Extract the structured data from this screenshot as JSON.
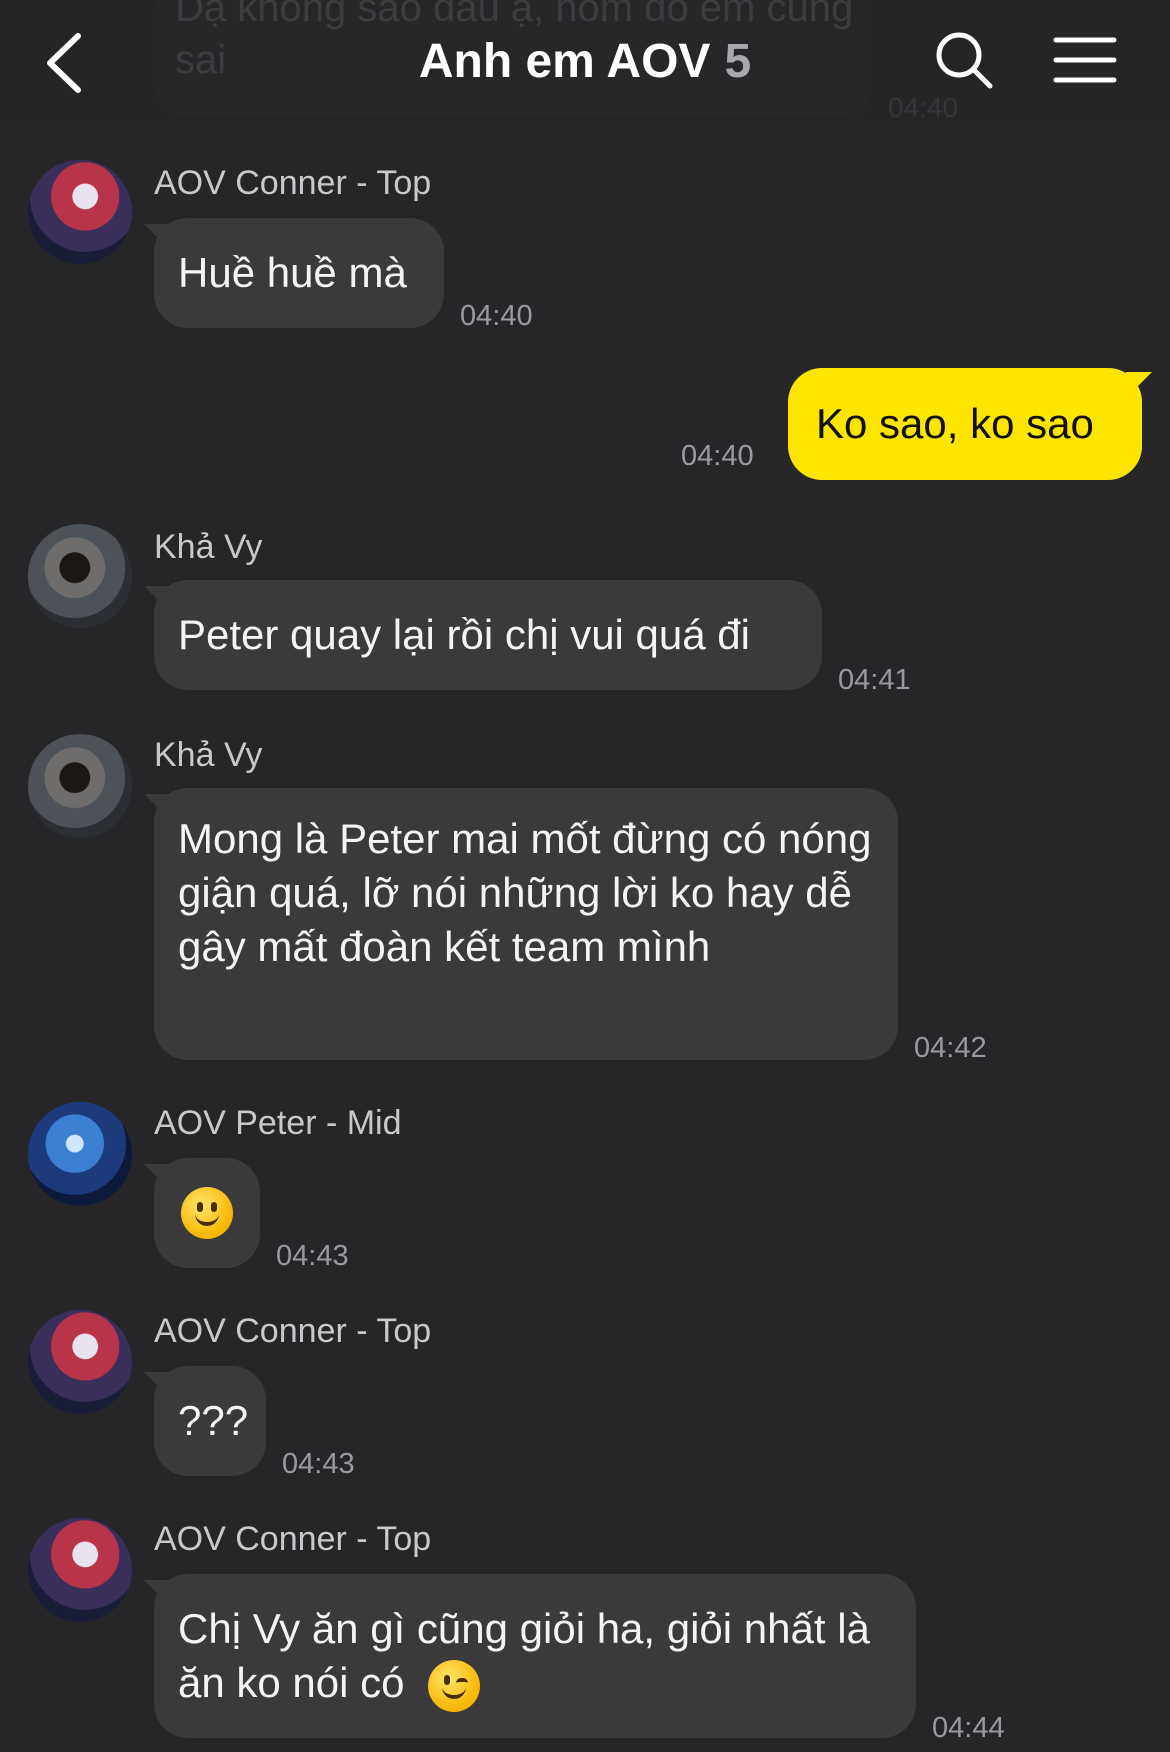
{
  "header": {
    "title": "Anh em AOV",
    "member_count": "5"
  },
  "ghost_message": {
    "text": "Dạ không sao đâu ạ, hôm đó em cũng sai",
    "time": "04:40"
  },
  "messages": [
    {
      "sender": "AOV Conner - Top",
      "text": "Huề huề mà",
      "time": "04:40"
    },
    {
      "sender": "",
      "text": "Ko sao, ko sao",
      "time": "04:40",
      "outgoing": true
    },
    {
      "sender": "Khả Vy",
      "text": "Peter quay lại rồi chị vui quá đi",
      "time": "04:41"
    },
    {
      "sender": "Khả Vy",
      "text": "Mong là Peter mai mốt đừng có nóng giận quá, lỡ nói những lời ko hay dễ gây mất đoàn kết team mình",
      "time": "04:42"
    },
    {
      "sender": "AOV Peter - Mid",
      "emoji": "slightly-smiling-face",
      "time": "04:43"
    },
    {
      "sender": "AOV Conner - Top",
      "text": "???",
      "time": "04:43"
    },
    {
      "sender": "AOV Conner - Top",
      "text": "Chị Vy ăn gì cũng giỏi ha, giỏi nhất là ăn ko nói có",
      "emoji": "winking-face",
      "time": "04:44"
    }
  ],
  "colors": {
    "background": "#262628",
    "incoming_bubble": "#3a3a3c",
    "outgoing_bubble": "#fee500"
  }
}
